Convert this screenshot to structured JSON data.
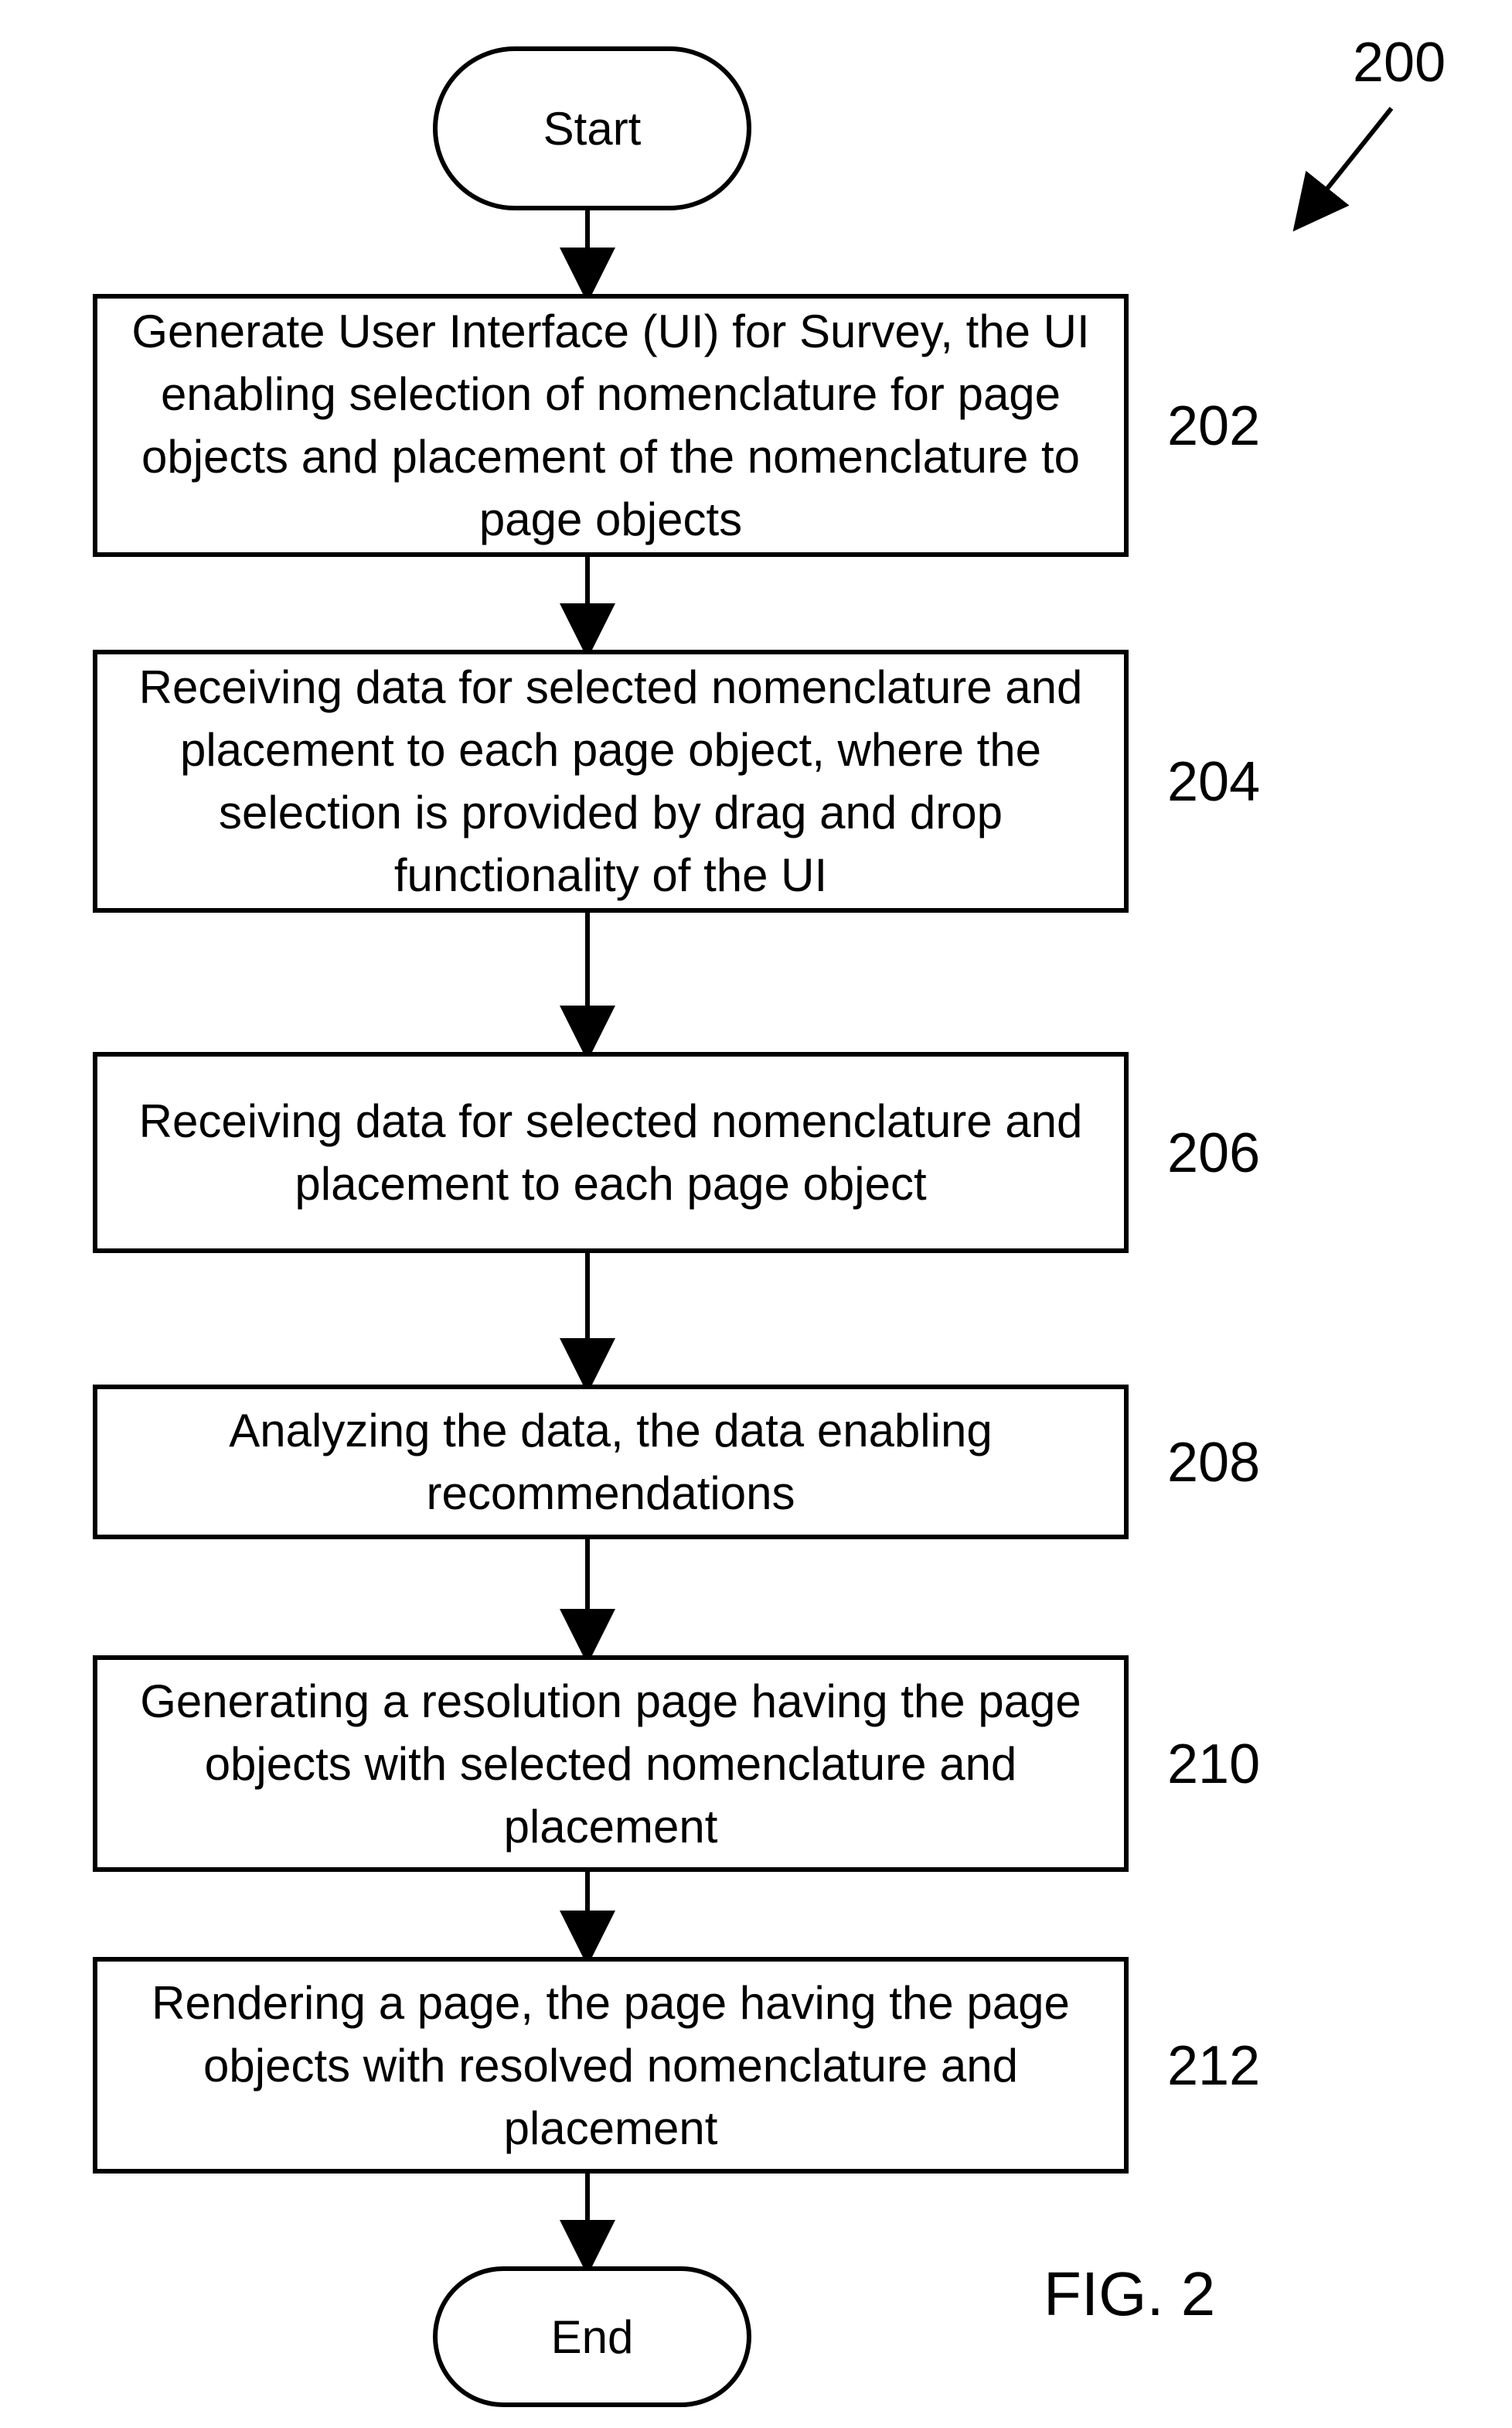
{
  "diagram": {
    "ref": "200",
    "figure": "FIG. 2",
    "start": "Start",
    "end": "End",
    "steps": [
      {
        "ref": "202",
        "text": "Generate User Interface (UI) for Survey, the UI enabling selection of nomenclature for page objects and placement of the nomenclature to page objects"
      },
      {
        "ref": "204",
        "text": "Receiving data for selected nomenclature and placement to each page object, where the selection is provided by drag and drop functionality of the UI"
      },
      {
        "ref": "206",
        "text": "Receiving data for selected nomenclature and placement to each page object"
      },
      {
        "ref": "208",
        "text": "Analyzing the data, the data enabling recommendations"
      },
      {
        "ref": "210",
        "text": "Generating a resolution page having the page objects with selected nomenclature and placement"
      },
      {
        "ref": "212",
        "text": "Rendering a page, the page having the page objects with resolved nomenclature and placement"
      }
    ]
  }
}
